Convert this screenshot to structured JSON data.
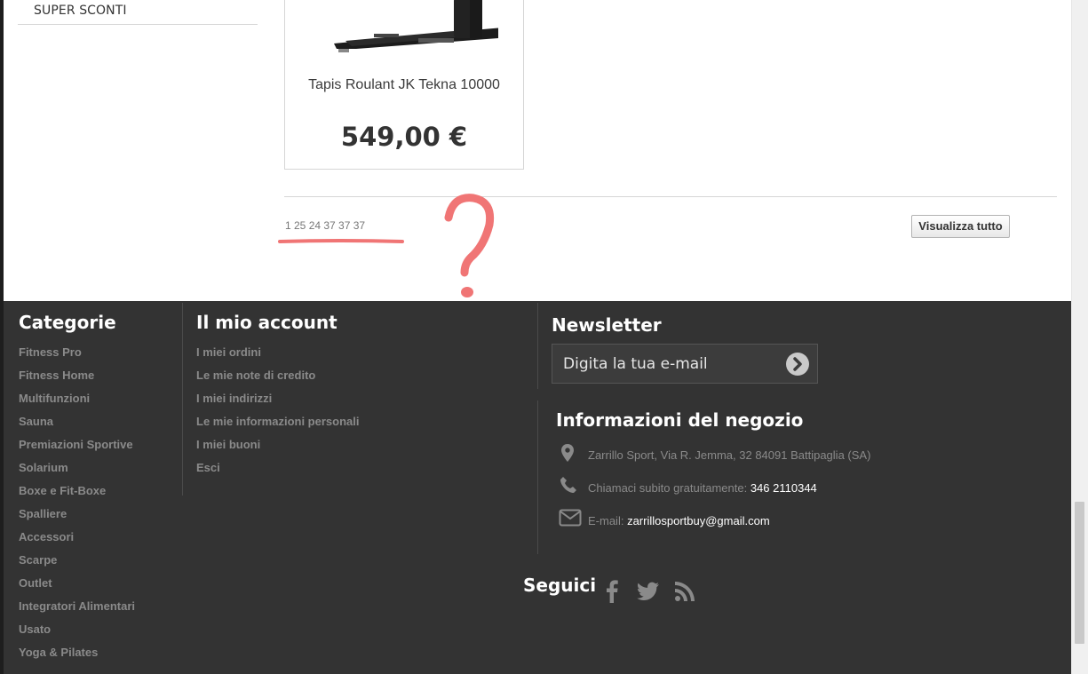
{
  "sidebar": {
    "link_label": "SUPER SCONTI"
  },
  "product": {
    "name": "Tapis Roulant JK Tekna 10000",
    "price": "549,00 €"
  },
  "pagination": {
    "text": "1 25 24 37 37 37"
  },
  "view_all_label": "Visualizza tutto",
  "annotation": {
    "mark": "?",
    "color": "#f07575"
  },
  "footer": {
    "categories": {
      "title": "Categorie",
      "items": [
        "Fitness Pro",
        "Fitness Home",
        "Multifunzioni",
        "Sauna",
        "Premiazioni Sportive",
        "Solarium",
        "Boxe e Fit-Boxe",
        "Spalliere",
        "Accessori",
        "Scarpe",
        "Outlet",
        "Integratori Alimentari",
        "Usato",
        "Yoga & Pilates"
      ]
    },
    "account": {
      "title": "Il mio account",
      "items": [
        "I miei ordini",
        "Le mie note di credito",
        "I miei indirizzi",
        "Le mie informazioni personali",
        "I miei buoni",
        "Esci"
      ]
    },
    "newsletter": {
      "title": "Newsletter",
      "placeholder": "Digita la tua e-mail"
    },
    "store_info": {
      "title": "Informazioni del negozio",
      "address": "Zarrillo Sport, Via R. Jemma, 32 84091 Battipaglia (SA)",
      "phone_label": "Chiamaci subito gratuitamente:",
      "phone": "346 2110344",
      "email_label": "E-mail:",
      "email": "zarrillosportbuy@gmail.com"
    },
    "social": {
      "title": "Seguici",
      "icons": [
        "facebook-icon",
        "twitter-icon",
        "rss-icon"
      ]
    },
    "colors": {
      "background": "#333333",
      "link": "#8a8a8a",
      "title": "#ffffff"
    }
  }
}
